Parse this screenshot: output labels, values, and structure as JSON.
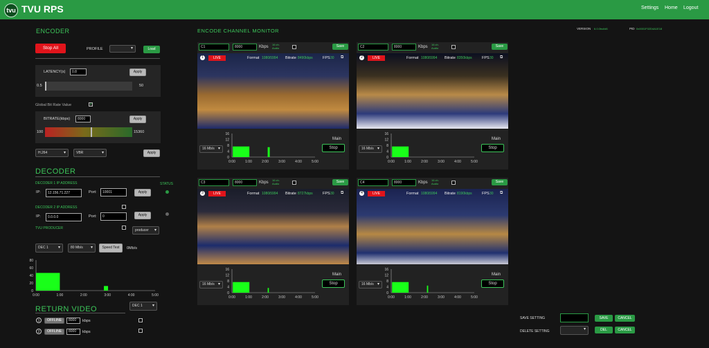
{
  "header": {
    "title": "TVU RPS",
    "logo_text": "tvu",
    "nav": [
      "Settings",
      "Home",
      "Logout"
    ]
  },
  "encoder": {
    "title": "ENCODER",
    "stop_all": "Stop All",
    "profile_label": "PROFILE",
    "profile_value": "",
    "load": "Load",
    "latency_label": "LATENCY(s)",
    "latency_value": "0.8",
    "apply": "Apply",
    "latency_min": "0.5",
    "latency_max": "50",
    "latency_level": 0.0,
    "global_bitrate_label": "Global Bit Rate Value",
    "global_bitrate_checked": true,
    "bitrate_label": "BITRATE(kbps)",
    "bitrate_value": "8000",
    "bitrate_min": "100",
    "bitrate_max": "15360",
    "bitrate_level": 0.52,
    "codec": "H.264",
    "mode": "VBR"
  },
  "decoder": {
    "title": "DECODER",
    "status_label": "STATUS",
    "d1_label": "DECODER 1 IP ADDRESS",
    "d1_ip": "12.156.71.227",
    "d1_port": "10001",
    "d2_label": "DECODER 2 IP ADDRESS",
    "d2_ip": "0.0.0.0",
    "d2_port": "0",
    "ip_label": "IP:",
    "port_label": "Port:",
    "tvu_producer": "TVU PRODUCER",
    "producer_dd": "producer",
    "dec_select": "DEC 1",
    "speed_select": "80 Mb/s",
    "speed_test": "Speed Test",
    "speed_result": "0Mb/s",
    "chart": {
      "y_ticks": [
        "80",
        "60",
        "40",
        "20",
        "0"
      ],
      "x_ticks": [
        "0:00",
        "1:00",
        "2:00",
        "3:00",
        "4:00",
        "5:00"
      ]
    }
  },
  "return_video": {
    "title": "RETURN VIDEO",
    "dec_select": "DEC 1",
    "rows": [
      {
        "num": "1",
        "status": "OFFLINE",
        "value": "8000",
        "unit": "kbps"
      },
      {
        "num": "2",
        "status": "OFFLINE",
        "value": "8000",
        "unit": "kbps"
      }
    ]
  },
  "monitor": {
    "title": "ENCODE CHANNEL MONITOR",
    "version_label": "VERSION",
    "version_value": "6.0.0build6",
    "pid_label": "PID",
    "pid_value": "0x0001F02D4A1E18",
    "channels": [
      {
        "name": "C1",
        "num": "1",
        "kbps_value": "8000",
        "kbps_label": "Kbps",
        "audio": "16 ch. Audio",
        "save": "Save",
        "live": "LIVE",
        "format_label": "Format",
        "format": "1080i5994",
        "bitrate_label": "Bitrate",
        "bitrate": "8490kbps",
        "fps_label": "FPS",
        "fps": "30",
        "speed": "16 Mb/s",
        "main": "Main",
        "stop": "Stop"
      },
      {
        "name": "C2",
        "num": "2",
        "kbps_value": "8000",
        "kbps_label": "Kbps",
        "audio": "16 ch. Audio",
        "save": "Save",
        "live": "LIVE",
        "format_label": "Format",
        "format": "1080i5994",
        "bitrate_label": "Bitrate",
        "bitrate": "8350kbps",
        "fps_label": "FPS",
        "fps": "30",
        "speed": "16 Mb/s",
        "main": "Main",
        "stop": "Stop"
      },
      {
        "name": "C3",
        "num": "3",
        "kbps_value": "8000",
        "kbps_label": "Kbps",
        "audio": "16 ch. Audio",
        "save": "Save",
        "live": "LIVE",
        "format_label": "Format",
        "format": "1080i5994",
        "bitrate_label": "Bitrate",
        "bitrate": "8727kbps",
        "fps_label": "FPS",
        "fps": "30",
        "speed": "16 Mb/s",
        "main": "Main",
        "stop": "Stop"
      },
      {
        "name": "C4",
        "num": "4",
        "kbps_value": "8000",
        "kbps_label": "Kbps",
        "audio": "16 ch. Audio",
        "save": "Save",
        "live": "LIVE",
        "format_label": "Format",
        "format": "1080i5994",
        "bitrate_label": "Bitrate",
        "bitrate": "8190kbps",
        "fps_label": "FPS",
        "fps": "30",
        "speed": "16 Mb/s",
        "main": "Main",
        "stop": "Stop"
      }
    ],
    "chart": {
      "y_ticks": [
        "16",
        "12",
        "8",
        "4",
        "0"
      ],
      "x_ticks": [
        "0:00",
        "1:00",
        "2:00",
        "3:00",
        "4:00",
        "5:00"
      ]
    }
  },
  "settings": {
    "save_label": "SAVE SETTING",
    "delete_label": "DELETE SETTING",
    "save": "SAVE",
    "cancel": "CANCEL",
    "del": "DEL"
  },
  "colors": {
    "accent": "#2a9a44",
    "live": "#e0141b",
    "graph": "#19ff19"
  }
}
